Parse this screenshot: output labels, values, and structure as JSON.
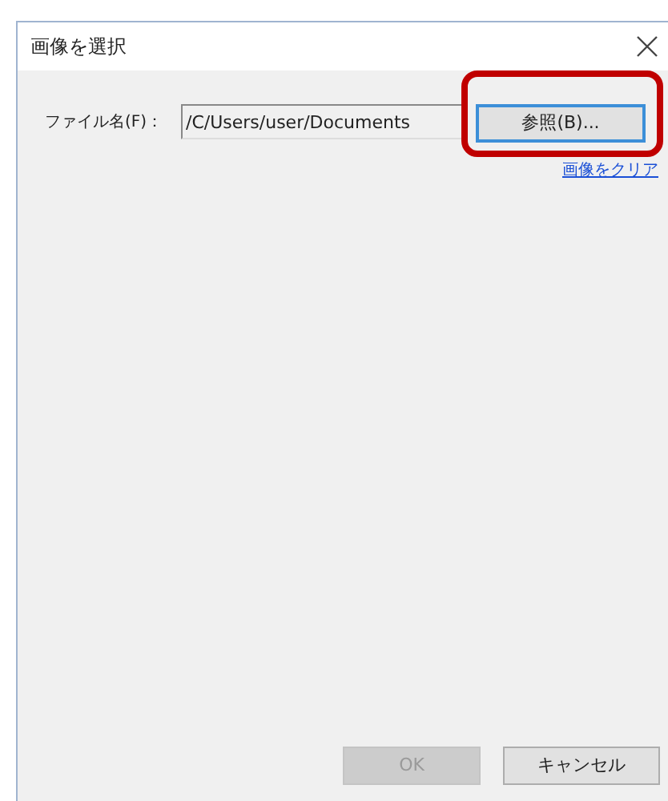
{
  "window": {
    "title": "画像を選択"
  },
  "file_field": {
    "label": "ファイル名(F)：",
    "value": "/C/Users/user/Documents"
  },
  "browse_button": {
    "label": "参照(B)...",
    "highlighted": true
  },
  "clear_link": {
    "label": "画像をクリア"
  },
  "buttons": [
    {
      "label": "OK",
      "disabled": true
    },
    {
      "label": "キャンセル",
      "disabled": false
    }
  ]
}
